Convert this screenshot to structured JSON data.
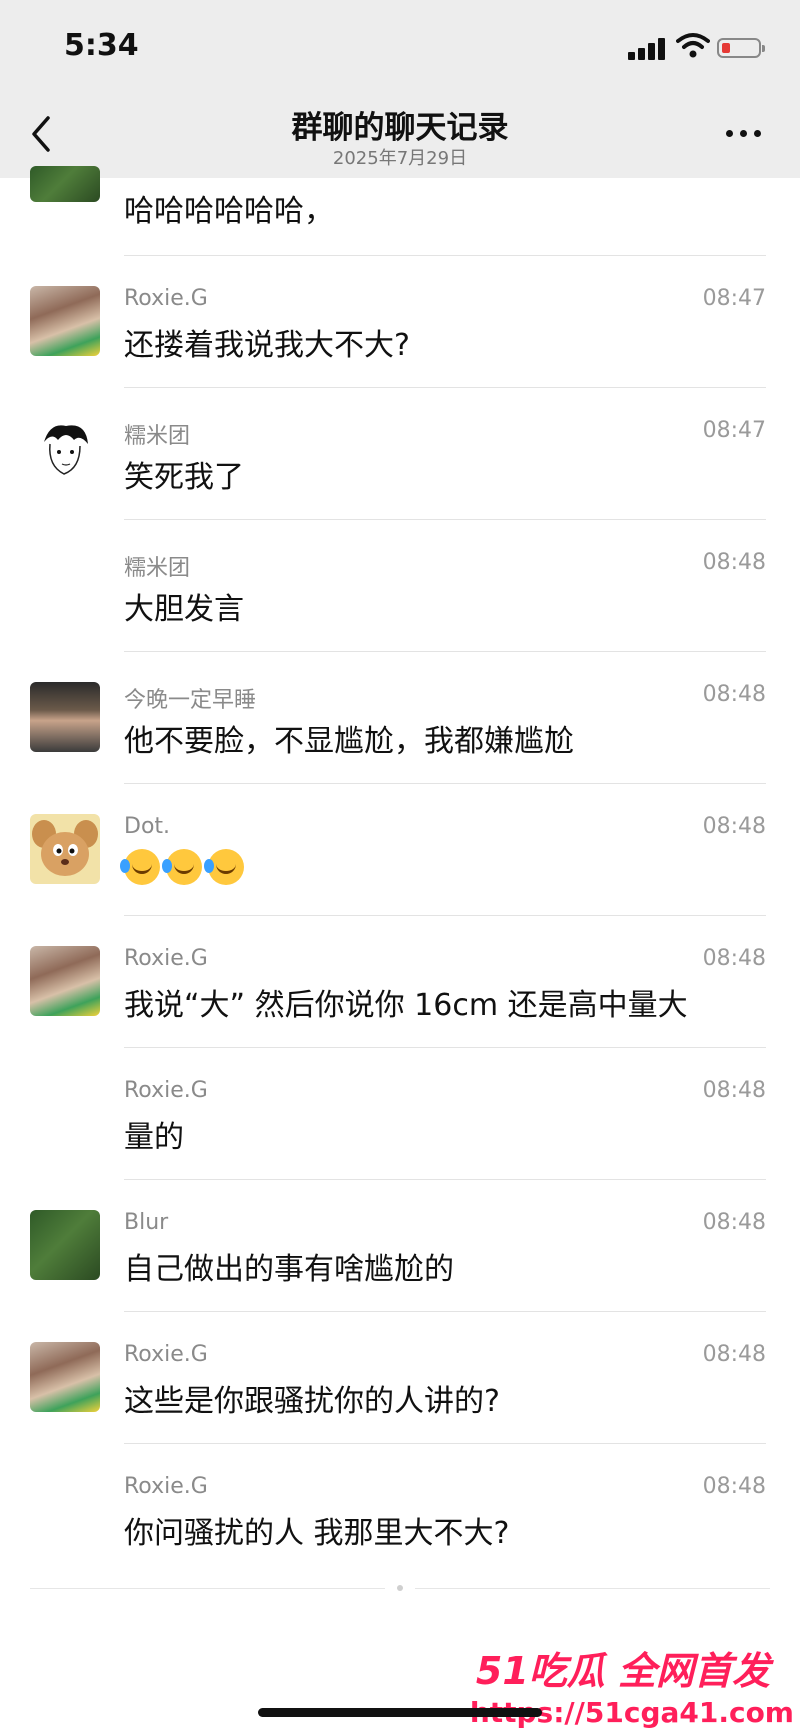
{
  "status_bar": {
    "time": "5:34"
  },
  "header": {
    "title": "群聊的聊天记录",
    "subtitle": "2025年7月29日"
  },
  "messages": [
    {
      "sender": "",
      "time": "",
      "text": "哈哈哈哈哈哈，",
      "avatar": "grass-avatar"
    },
    {
      "sender": "Roxie.G",
      "time": "08:47",
      "text": "还搂着我说我大不大?",
      "avatar": "photo-avatar"
    },
    {
      "sender": "糯米团",
      "time": "08:47",
      "text": "笑死我了",
      "avatar": "sketch-avatar"
    },
    {
      "sender": "糯米团",
      "time": "08:48",
      "text": "大胆发言",
      "avatar": ""
    },
    {
      "sender": "今晚一定早睡",
      "time": "08:48",
      "text": "他不要脸，不显尴尬，我都嫌尴尬",
      "avatar": "man-avatar"
    },
    {
      "sender": "Dot.",
      "time": "08:48",
      "text": "",
      "avatar": "jerry-avatar",
      "emoji": [
        "laugh-cry-emoji",
        "laugh-cry-emoji",
        "laugh-cry-emoji"
      ]
    },
    {
      "sender": "Roxie.G",
      "time": "08:48",
      "text": "我说“大” 然后你说你 16cm 还是高中量大",
      "avatar": "photo-avatar"
    },
    {
      "sender": "Roxie.G",
      "time": "08:48",
      "text": "量的",
      "avatar": ""
    },
    {
      "sender": "Blur",
      "time": "08:48",
      "text": "自己做出的事有啥尴尬的",
      "avatar": "grass-avatar"
    },
    {
      "sender": "Roxie.G",
      "time": "08:48",
      "text": "这些是你跟骚扰你的人讲的?",
      "avatar": "photo-avatar"
    },
    {
      "sender": "Roxie.G",
      "time": "08:48",
      "text": "你问骚扰的人 我那里大不大?",
      "avatar": ""
    }
  ],
  "watermark": {
    "brand": "51吃瓜 全网首发",
    "url": "https://51cga41.com"
  },
  "colors": {
    "header_bg": "#ededed",
    "watermark": "#ff1f5a",
    "divider": "#e3e3e3"
  }
}
